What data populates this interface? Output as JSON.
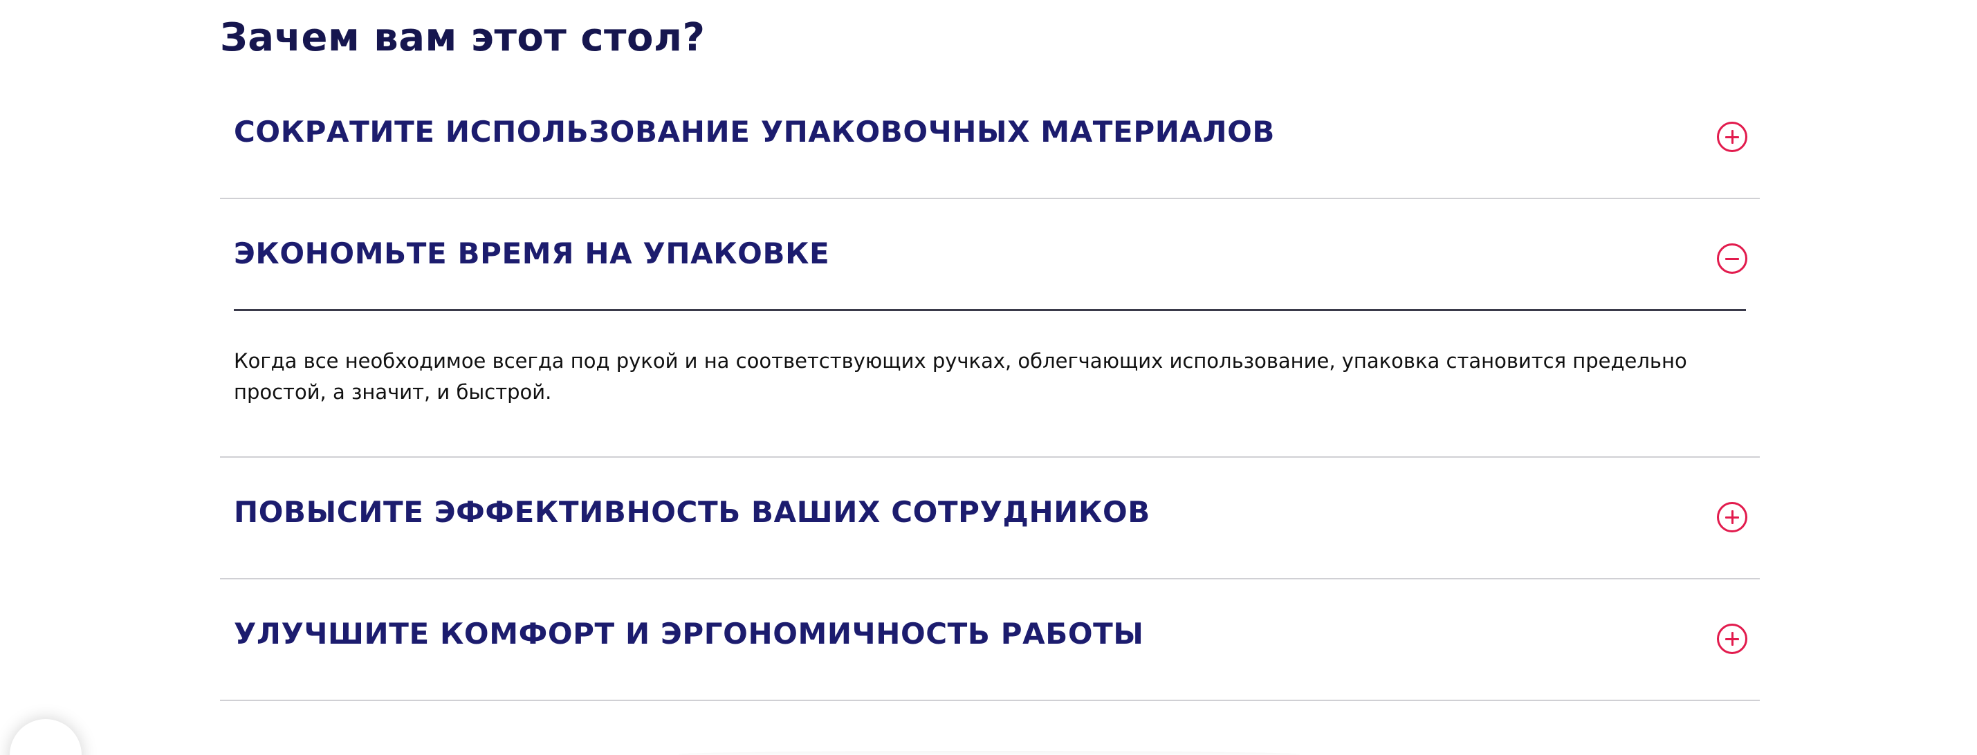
{
  "section": {
    "title": "Зачем вам этот стол?"
  },
  "accordion": {
    "items": [
      {
        "title": "СОКРАТИТЕ ИСПОЛЬЗОВАНИЕ УПАКОВОЧНЫХ МАТЕРИАЛОВ",
        "expanded": false,
        "toggle_icon": "plus-circle-icon"
      },
      {
        "title": "ЭКОНОМЬТЕ ВРЕМЯ НА УПАКОВКЕ",
        "expanded": true,
        "toggle_icon": "minus-circle-icon",
        "body": "Когда все необходимое всегда под рукой и на соответствующих ручках, облегчающих использование, упаковка становится предельно простой, а значит, и быстрой."
      },
      {
        "title": "ПОВЫСИТЕ ЭФФЕКТИВНОСТЬ ВАШИХ СОТРУДНИКОВ",
        "expanded": false,
        "toggle_icon": "plus-circle-icon"
      },
      {
        "title": "УЛУЧШИТЕ КОМФОРТ И ЭРГОНОМИЧНОСТЬ РАБОТЫ",
        "expanded": false,
        "toggle_icon": "plus-circle-icon"
      }
    ]
  },
  "colors": {
    "heading": "#16164f",
    "item_title": "#1c1c6e",
    "accent": "#e21b4d",
    "divider": "#d0d0d4",
    "active_divider": "#3a3a4a",
    "body_text": "#111111"
  }
}
